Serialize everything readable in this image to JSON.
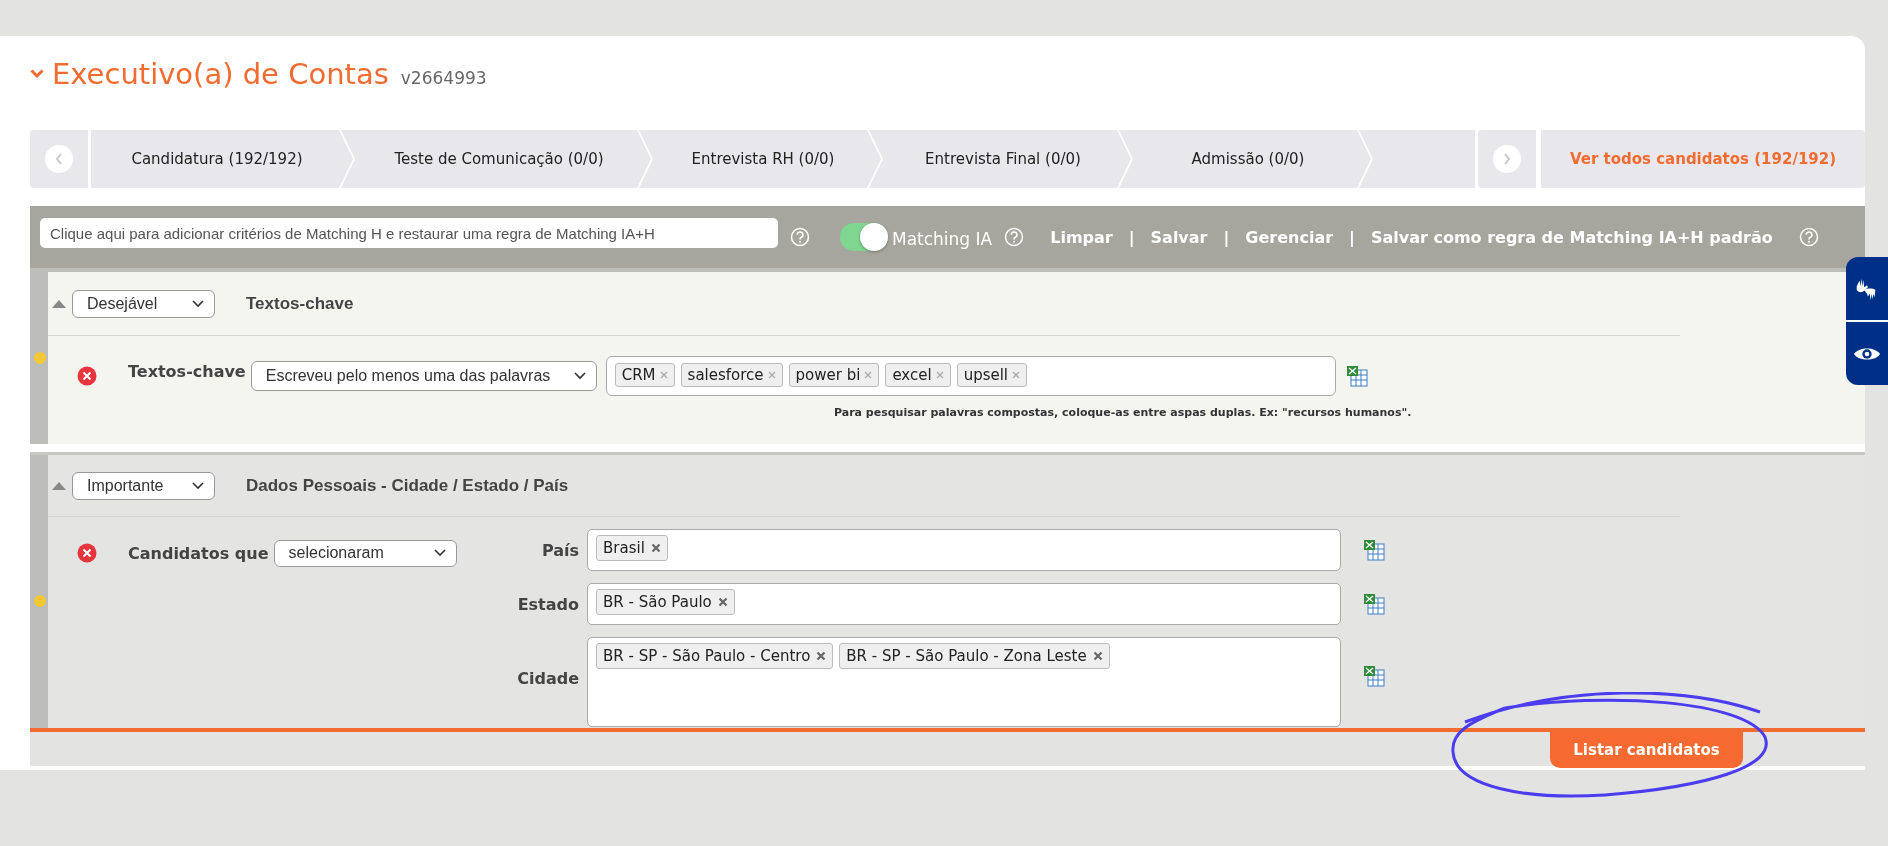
{
  "job": {
    "title": "Executivo(a) de Contas",
    "version": "v2664993",
    "expanded": true
  },
  "stages": [
    {
      "label": "Candidatura (192/192)"
    },
    {
      "label": "Teste de Comunicação (0/0)"
    },
    {
      "label": "Entrevista RH (0/0)"
    },
    {
      "label": "Entrevista Final (0/0)"
    },
    {
      "label": "Admissão (0/0)"
    }
  ],
  "all_candidates": "Ver todos candidatos (192/192)",
  "filter_bar": {
    "placeholder": "Clique aqui para adicionar critérios de Matching H e restaurar uma regra de Matching IA+H",
    "matching_ia": {
      "label": "Matching IA",
      "on": true
    },
    "links": [
      "Limpar",
      "Salvar",
      "Gerenciar",
      "Salvar como regra de Matching IA+H padrão"
    ],
    "separators": [
      "|",
      "|",
      "|"
    ]
  },
  "criteria": [
    {
      "kind": "keywords",
      "priority": "Desejável",
      "title": "Textos-chave",
      "label": "Textos-chave",
      "mode": "Escreveu pelo menos uma das palavras",
      "tags": [
        "CRM",
        "salesforce",
        "power bi",
        "excel",
        "upsell"
      ],
      "hint": "Para pesquisar palavras compostas, coloque-as entre aspas duplas. Ex: \"recursos humanos\"."
    },
    {
      "kind": "location",
      "priority": "Importante",
      "title": "Dados Pessoais - Cidade / Estado / País",
      "label": "Candidatos que",
      "mode": "selecionaram",
      "fields": [
        {
          "label": "País",
          "tags": [
            "Brasil"
          ]
        },
        {
          "label": "Estado",
          "tags": [
            "BR - São Paulo"
          ]
        },
        {
          "label": "Cidade",
          "tags": [
            "BR - SP - São Paulo - Centro",
            "BR - SP - São Paulo - Zona Leste"
          ]
        }
      ]
    }
  ],
  "submit": "Listar candidatos"
}
